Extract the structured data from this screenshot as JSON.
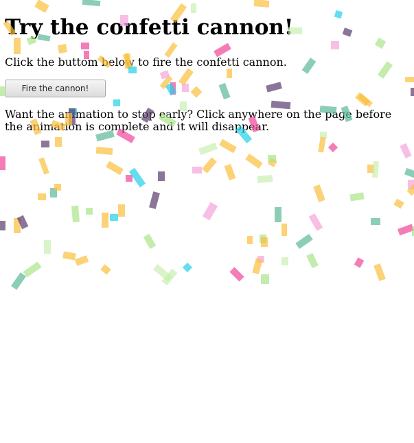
{
  "page": {
    "heading": "Try the confetti cannon!",
    "intro": "Click the buttom below to fire the confetti cannon.",
    "button_label": "Fire the cannon!",
    "note": "Want the animation to stop early? Click anywhere on the page before the animation is complete and it will disappear."
  },
  "confetti": {
    "colors": [
      "#fbbf3c",
      "#a9e48a",
      "#f0469a",
      "#1fd0e8",
      "#5a3a6e",
      "#5bb896",
      "#f3a4dc",
      "#c8f0b0"
    ]
  }
}
